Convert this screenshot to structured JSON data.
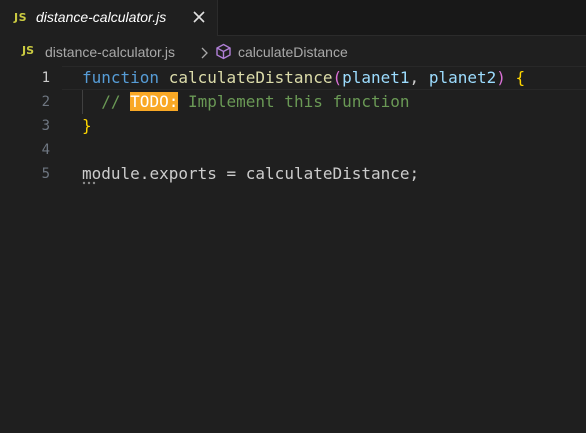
{
  "tab": {
    "lang_badge": "JS",
    "filename": "distance-calculator.js",
    "close_icon": "close-icon"
  },
  "breadcrumb": {
    "lang_badge": "JS",
    "file": "distance-calculator.js",
    "separator_icon": "chevron-right-icon",
    "symbol_icon": "symbol-cube-icon",
    "symbol": "calculateDistance"
  },
  "editor": {
    "active_line": 1,
    "lines": [
      {
        "number": "1",
        "tokens": {
          "kw": "function",
          "fn": "calculateDistance",
          "open_paren": "(",
          "p1": "planet1",
          "comma": ", ",
          "p2": "planet2",
          "close_paren": ")",
          "brace": "{"
        }
      },
      {
        "number": "2",
        "tokens": {
          "comment_start": "// ",
          "todo": "TODO:",
          "comment_rest": " Implement this function"
        }
      },
      {
        "number": "3",
        "tokens": {
          "brace": "}"
        }
      },
      {
        "number": "4",
        "tokens": {}
      },
      {
        "number": "5",
        "tokens": {
          "module": "module",
          "dot": ".",
          "exports": "exports",
          "assign": " = ",
          "fn": "calculateDistance",
          "semi": ";"
        }
      }
    ]
  },
  "colors": {
    "background": "#1f1f1f",
    "keyword": "#569cd6",
    "function": "#dcdcaa",
    "parameter": "#9cdcfe",
    "bracket": "#ffd700",
    "comment": "#6a9955",
    "todo_highlight": "#f9a825",
    "js_badge": "#cbcb41",
    "symbol_icon": "#b180d7"
  }
}
